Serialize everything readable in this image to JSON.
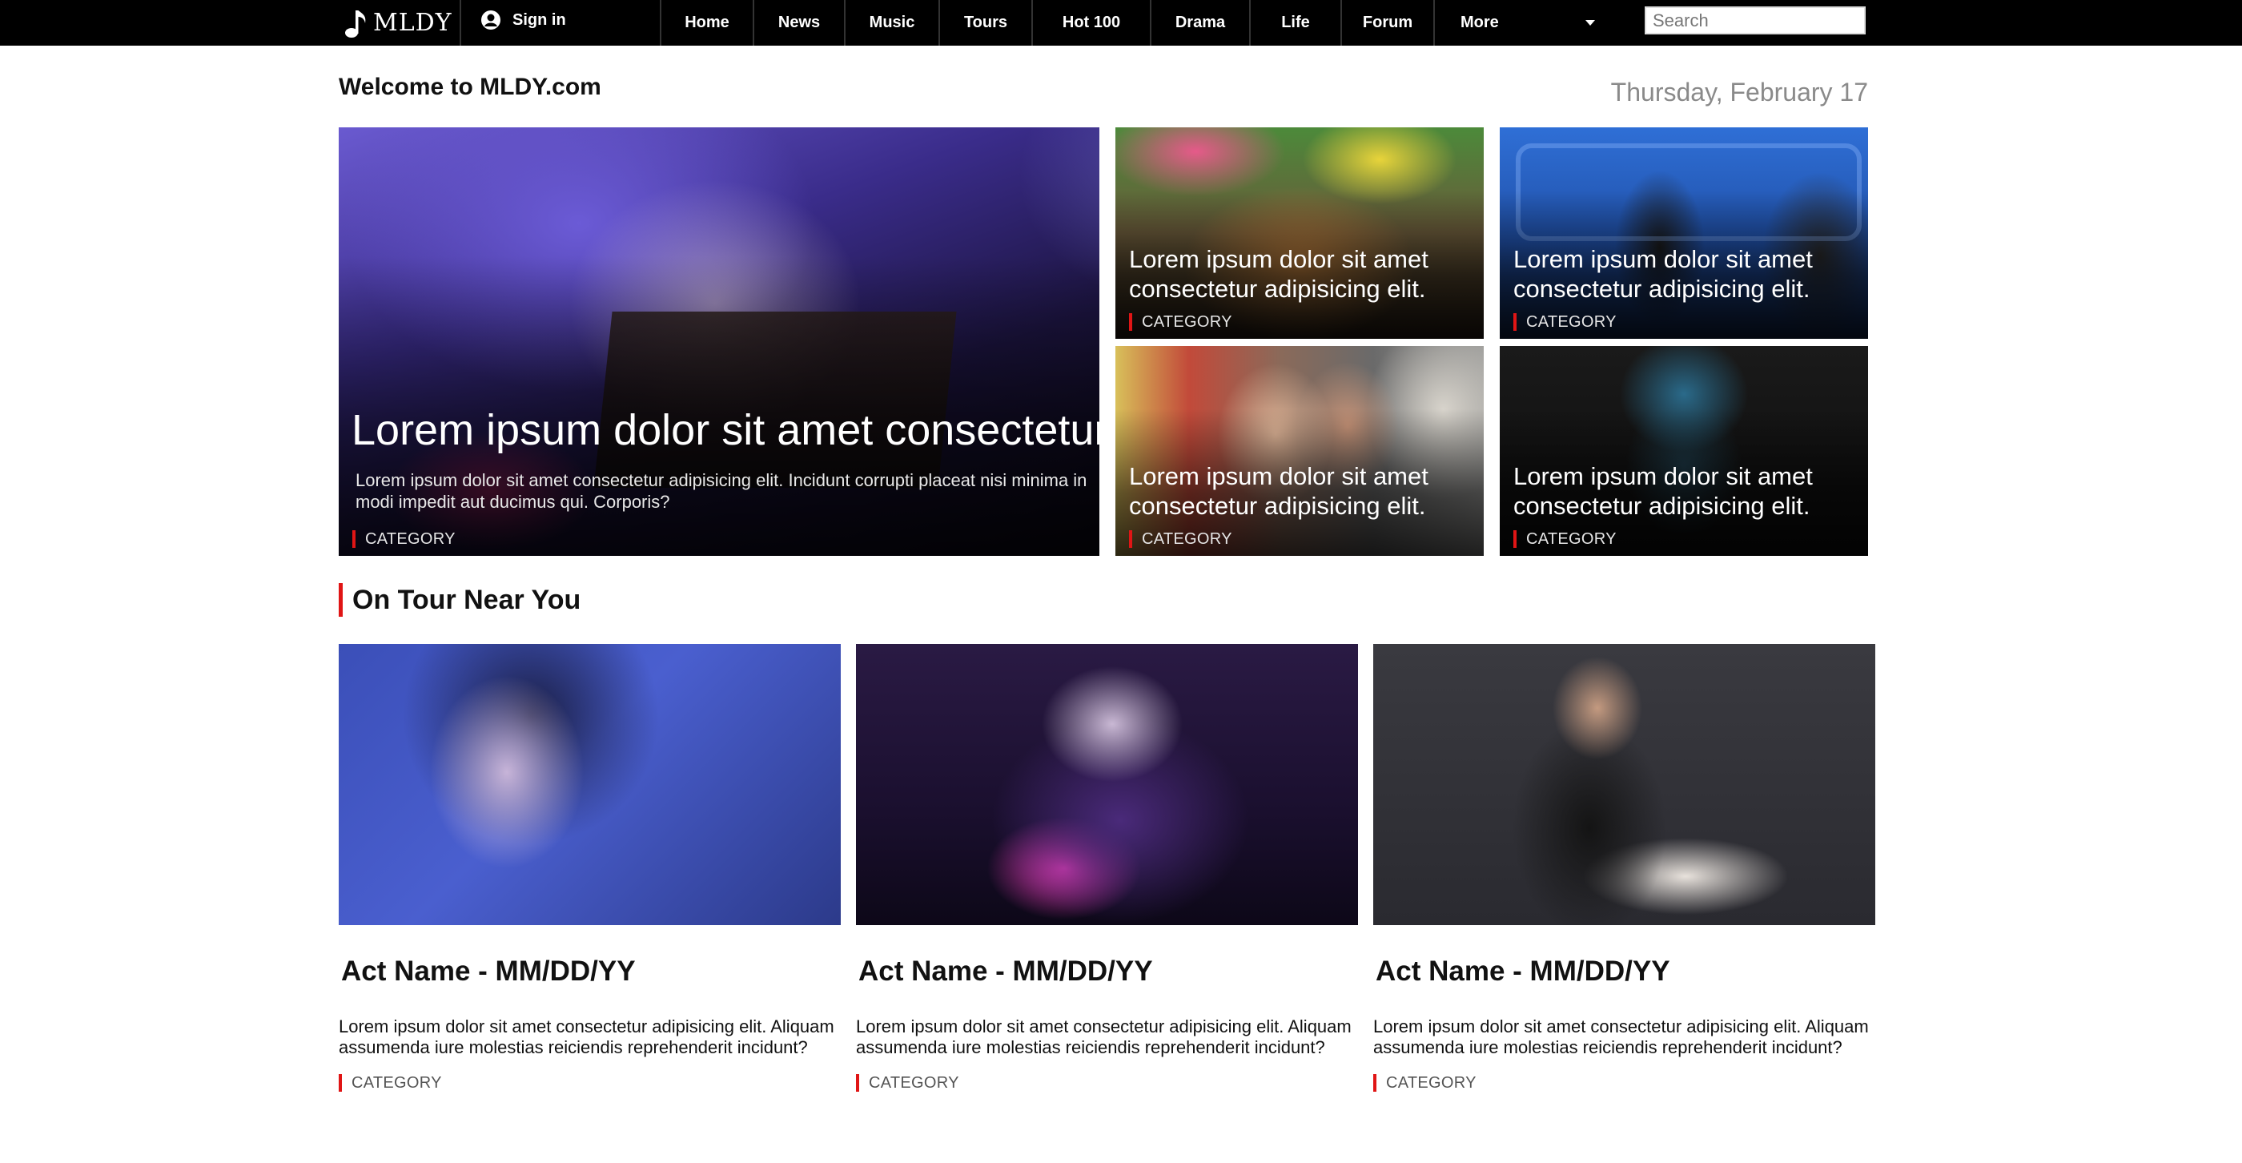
{
  "brand": {
    "name": "MLDY"
  },
  "signin": {
    "label": "Sign in"
  },
  "nav": {
    "items": [
      "Home",
      "News",
      "Music",
      "Tours",
      "Hot 100",
      "Drama",
      "Life",
      "Forum"
    ],
    "more_label": "More"
  },
  "search": {
    "placeholder": "Search"
  },
  "header": {
    "welcome": "Welcome to MLDY.com",
    "date": "Thursday, February 17"
  },
  "featured": {
    "main": {
      "title": "Lorem ipsum dolor sit amet consectetur",
      "description": "Lorem ipsum dolor sit amet consectetur adipisicing elit. Incidunt corrupti placeat nisi minima in modi impedit aut ducimus qui. Corporis?",
      "category": "CATEGORY"
    },
    "small": [
      {
        "title": "Lorem ipsum dolor sit amet consectetur adipisicing elit.",
        "category": "CATEGORY"
      },
      {
        "title": "Lorem ipsum dolor sit amet consectetur adipisicing elit.",
        "category": "CATEGORY"
      },
      {
        "title": "Lorem ipsum dolor sit amet consectetur adipisicing elit.",
        "category": "CATEGORY"
      },
      {
        "title": "Lorem ipsum dolor sit amet consectetur adipisicing elit.",
        "category": "CATEGORY"
      }
    ]
  },
  "tour": {
    "title": "On Tour Near You",
    "cards": [
      {
        "act": "Act Name - MM/DD/YY",
        "description": "Lorem ipsum dolor sit amet consectetur adipisicing elit. Aliquam assumenda iure molestias reiciendis reprehenderit incidunt?",
        "category": "CATEGORY"
      },
      {
        "act": "Act Name - MM/DD/YY",
        "description": "Lorem ipsum dolor sit amet consectetur adipisicing elit. Aliquam assumenda iure molestias reiciendis reprehenderit incidunt?",
        "category": "CATEGORY"
      },
      {
        "act": "Act Name - MM/DD/YY",
        "description": "Lorem ipsum dolor sit amet consectetur adipisicing elit. Aliquam assumenda iure molestias reiciendis reprehenderit incidunt?",
        "category": "CATEGORY"
      }
    ]
  },
  "colors": {
    "accent": "#e01515",
    "nav_bg": "#000000",
    "date_text": "#8a8a8a"
  },
  "icons": {
    "brand": "music-note-icon",
    "signin": "user-circle-icon",
    "more": "caret-down-icon"
  }
}
